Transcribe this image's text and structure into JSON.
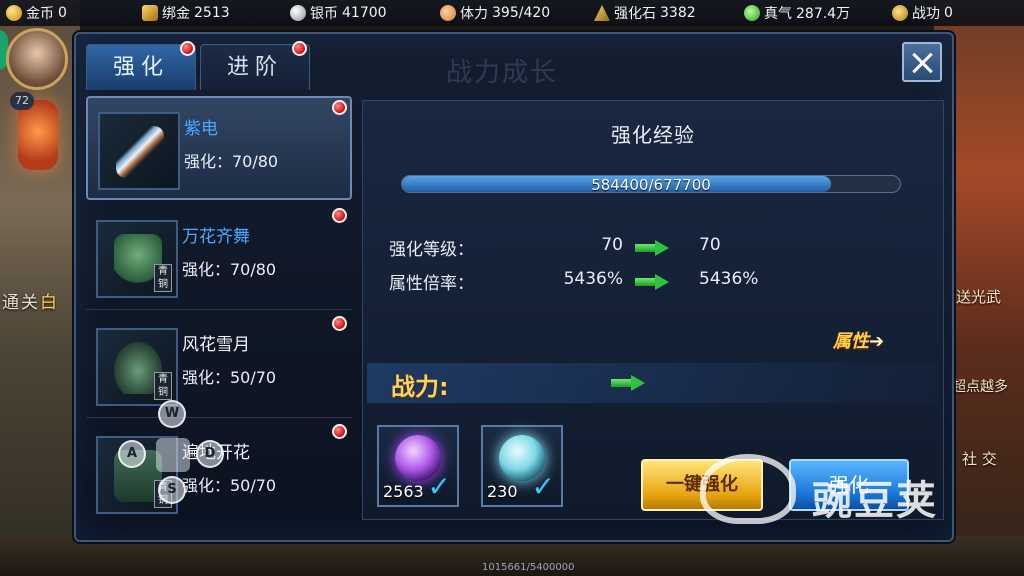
{
  "topbar": {
    "resources": [
      {
        "icon": "gold-coin-icon",
        "label": "金币",
        "value": "0"
      },
      {
        "icon": "bound-gold-icon",
        "label": "绑金",
        "value": "2513"
      },
      {
        "icon": "silver-coin-icon",
        "label": "银币",
        "value": "41700"
      },
      {
        "icon": "stamina-icon",
        "label": "体力",
        "value": "395/420"
      },
      {
        "icon": "enhance-stone-icon",
        "label": "强化石",
        "value": "3382"
      },
      {
        "icon": "true-qi-icon",
        "label": "真气",
        "value": "287.4万"
      },
      {
        "icon": "merit-icon",
        "label": "战功",
        "value": "0"
      }
    ]
  },
  "player": {
    "level": "72"
  },
  "side_left": {
    "text_a": "通关",
    "text_b": "白"
  },
  "side_right": {
    "line1": "送光武",
    "line2": "超点越多",
    "line3": "社 交"
  },
  "dialog": {
    "ghost_title": "战力成长",
    "tabs": [
      {
        "label": "强化",
        "active": true
      },
      {
        "label": "进阶",
        "active": false
      }
    ],
    "items": [
      {
        "name": "紫电",
        "name_color": "blue",
        "level_label": "强化：70/80",
        "tag": "",
        "icon": "weapon-icon",
        "selected": true
      },
      {
        "name": "万花齐舞",
        "name_color": "blue",
        "level_label": "强化：70/80",
        "tag": "青铜",
        "icon": "armor-icon",
        "selected": false
      },
      {
        "name": "风花雪月",
        "name_color": "white",
        "level_label": "强化：50/70",
        "tag": "青铜",
        "icon": "belt-icon",
        "selected": false
      },
      {
        "name": "遍地开花",
        "name_color": "white",
        "level_label": "强化：50/70",
        "tag": "青铜",
        "icon": "boots-icon",
        "selected": false
      }
    ],
    "panel": {
      "title": "强化经验",
      "xp_text": "584400/677700",
      "xp_fraction": 0.862,
      "stats": [
        {
          "label": "强化等级：",
          "from": "70",
          "to": "70"
        },
        {
          "label": "属性倍率：",
          "from": "5436%",
          "to": "5436%"
        }
      ],
      "attr_link": "属性",
      "power_label": "战力:",
      "materials": [
        {
          "count": "2563",
          "orb": "purple",
          "checked": true
        },
        {
          "count": "230",
          "orb": "teal",
          "checked": true
        }
      ],
      "btn_onekey": "一键强化",
      "btn_strengthen": "强化"
    }
  },
  "gamepad": {
    "keys": [
      "W",
      "A",
      "D",
      "S"
    ]
  },
  "watermark": {
    "text": "豌豆荚"
  },
  "footer": {
    "hp_text": "1015661/5400000"
  }
}
